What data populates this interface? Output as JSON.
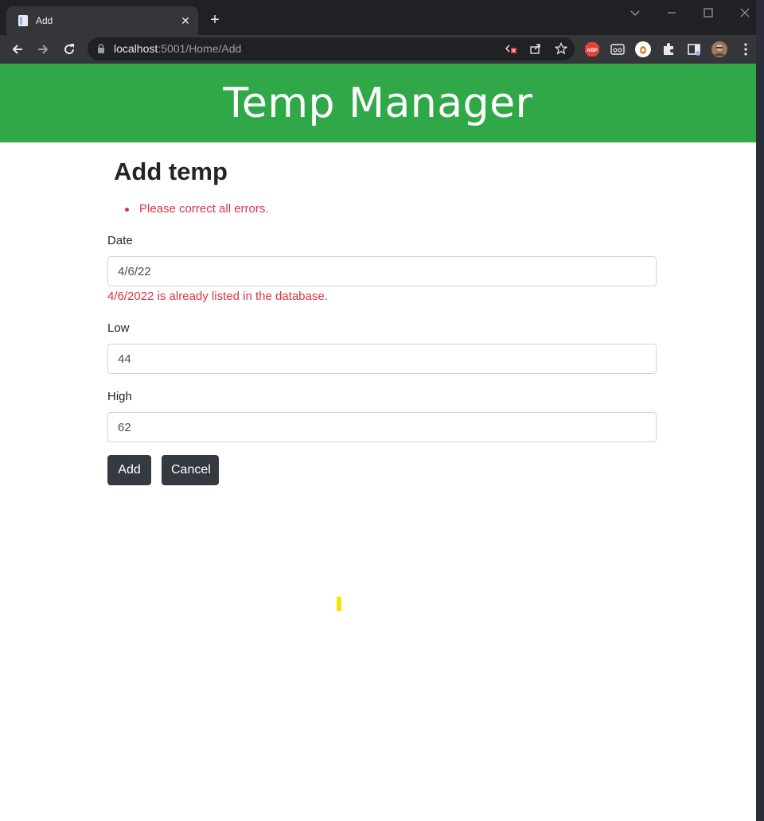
{
  "browser": {
    "tab_title": "Add",
    "tab_close": "✕",
    "new_tab": "+",
    "url_host": "localhost",
    "url_rest": ":5001/Home/Add",
    "extension_abp": "ABP"
  },
  "page": {
    "banner_title": "Temp Manager",
    "heading": "Add temp",
    "validation_summary": "Please correct all errors.",
    "form": {
      "date_label": "Date",
      "date_value": "4/6/22",
      "date_error": "4/6/2022 is already listed in the database.",
      "low_label": "Low",
      "low_value": "44",
      "high_label": "High",
      "high_value": "62"
    },
    "buttons": {
      "add_label": "Add",
      "cancel_label": "Cancel"
    }
  },
  "colors": {
    "banner": "#30a848",
    "error": "#dc3545",
    "button": "#343a40"
  }
}
